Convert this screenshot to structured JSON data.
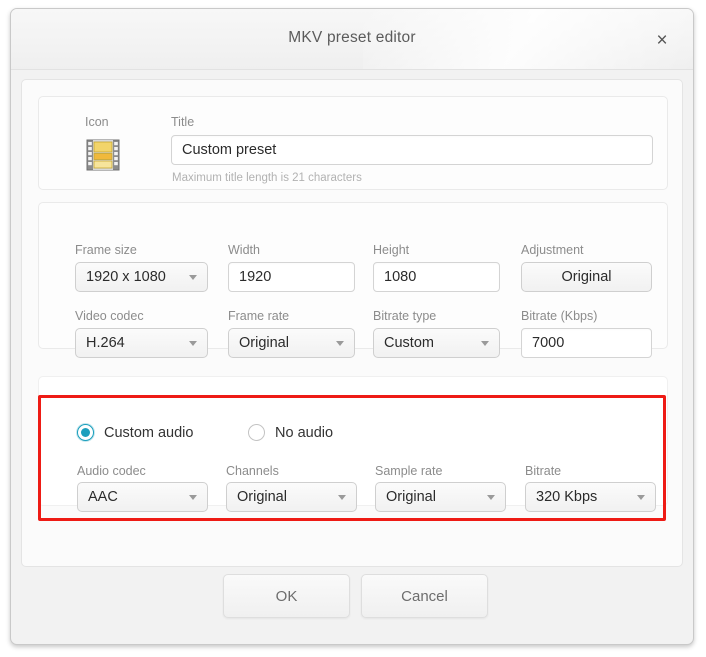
{
  "window": {
    "title": "MKV preset editor",
    "close_label": "×"
  },
  "title_section": {
    "icon_label": "Icon",
    "icon_name": "film-strip-icon",
    "title_label": "Title",
    "title_value": "Custom preset",
    "title_placeholder": "Custom preset",
    "hint": "Maximum title length is 21 characters"
  },
  "video_section": {
    "frame_size": {
      "label": "Frame size",
      "value": "1920 x 1080",
      "type": "dropdown"
    },
    "width": {
      "label": "Width",
      "value": "1920",
      "type": "input"
    },
    "height": {
      "label": "Height",
      "value": "1080",
      "type": "input"
    },
    "adjustment": {
      "label": "Adjustment",
      "value": "Original",
      "type": "button"
    },
    "video_codec": {
      "label": "Video codec",
      "value": "H.264",
      "type": "dropdown"
    },
    "frame_rate": {
      "label": "Frame rate",
      "value": "Original",
      "type": "dropdown"
    },
    "bitrate_type": {
      "label": "Bitrate type",
      "value": "Custom",
      "type": "dropdown"
    },
    "bitrate": {
      "label": "Bitrate (Kbps)",
      "value": "7000",
      "type": "input"
    }
  },
  "audio_section": {
    "radio_custom": {
      "label": "Custom audio",
      "checked": true
    },
    "radio_none": {
      "label": "No audio",
      "checked": false
    },
    "audio_codec": {
      "label": "Audio codec",
      "value": "AAC",
      "type": "dropdown"
    },
    "channels": {
      "label": "Channels",
      "value": "Original",
      "type": "dropdown"
    },
    "sample_rate": {
      "label": "Sample rate",
      "value": "Original",
      "type": "dropdown"
    },
    "bitrate": {
      "label": "Bitrate",
      "value": "320 Kbps",
      "type": "dropdown"
    }
  },
  "footer": {
    "ok_label": "OK",
    "cancel_label": "Cancel"
  },
  "annotation": {
    "highlight_color": "#ee1b15"
  },
  "colors": {
    "accent_radio": "#1c9fbd",
    "dialog_bg": "#f2f2f2",
    "panel_bg": "#fbfbfb",
    "label_text": "#8c8c8c",
    "value_text": "#2b2b2b",
    "title_text": "#5b5b5b"
  }
}
